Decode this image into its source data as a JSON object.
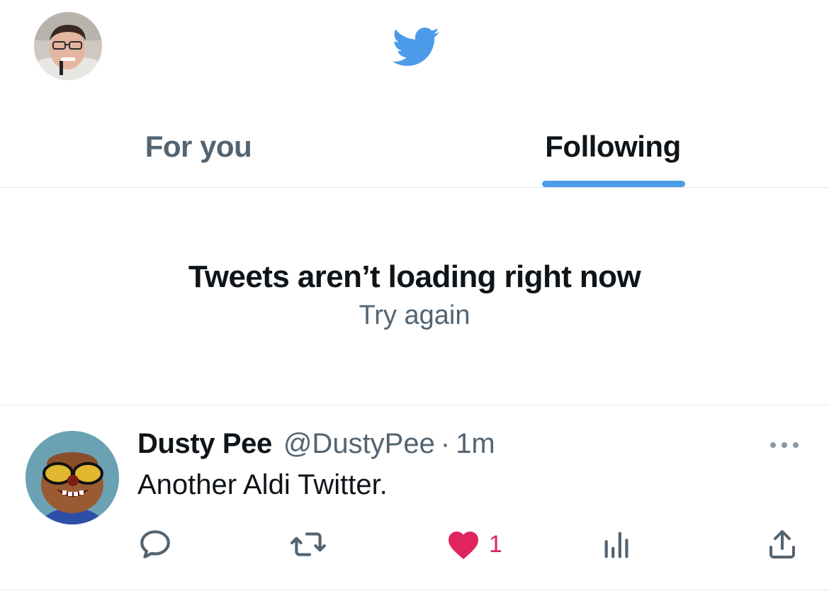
{
  "colors": {
    "brand": "#4c9be8",
    "text_primary": "#0f1419",
    "text_secondary": "#536471",
    "like": "#e0245e",
    "divider": "#e1e6ea"
  },
  "header": {
    "logo_icon": "twitter-bird-icon",
    "profile_avatar_icon": "user-avatar"
  },
  "tabs": [
    {
      "label": "For you",
      "selected": false
    },
    {
      "label": "Following",
      "selected": true
    }
  ],
  "error": {
    "title": "Tweets aren’t loading right now",
    "retry_label": "Try again"
  },
  "tweet": {
    "name": "Dusty Pee",
    "handle": "@DustyPee",
    "separator": "·",
    "time": "1m",
    "text": "Another Aldi Twitter.",
    "more_icon": "more-horizontal-icon",
    "actions": {
      "reply_icon": "reply-icon",
      "retweet_icon": "retweet-icon",
      "like_icon": "heart-icon",
      "like_count": "1",
      "views_icon": "views-icon",
      "share_icon": "share-icon"
    }
  }
}
